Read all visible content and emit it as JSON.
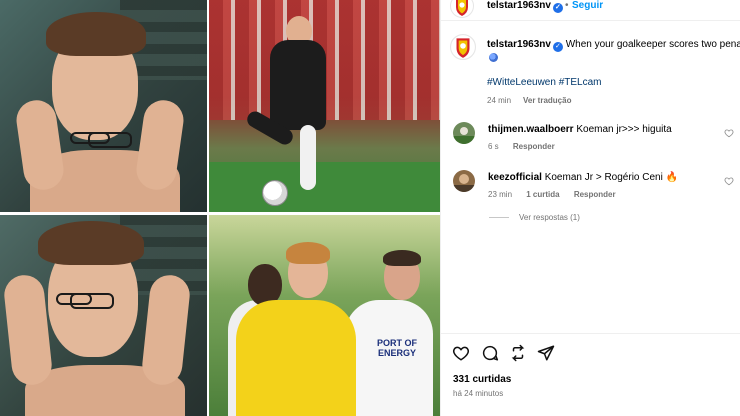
{
  "post": {
    "username": "telstar1963nv",
    "follow_label": "Seguir",
    "separator": "•",
    "caption_text": "When your goalkeeper scores two penal",
    "hashtags": "#WitteLeeuwen #TELcam",
    "caption_time": "24 min",
    "see_translation": "Ver tradução",
    "kit_sponsor_text": "PORT OF ENERGY"
  },
  "comments": [
    {
      "username": "thijmen.waalboerr",
      "text": "Koeman jr>>> higuita",
      "time": "6 s",
      "reply_label": "Responder"
    },
    {
      "username": "keezofficial",
      "text": "Koeman Jr > Rogério Ceni 🔥",
      "time": "23 min",
      "likes": "1 curtida",
      "reply_label": "Responder",
      "view_replies": "Ver respostas (1)"
    }
  ],
  "footer": {
    "likes": "331 curtidas",
    "posted": "há 24 minutos"
  },
  "icons": {
    "like": "heart-icon",
    "comment": "comment-icon",
    "repost": "repost-icon",
    "share": "send-icon",
    "verified": "verified-badge-icon"
  },
  "colors": {
    "link_blue": "#0095f6",
    "hashtag": "#00376b",
    "muted": "#737373",
    "verified": "#1f6fe8",
    "telstar_red": "#d6242a",
    "telstar_yellow": "#f2c200"
  }
}
